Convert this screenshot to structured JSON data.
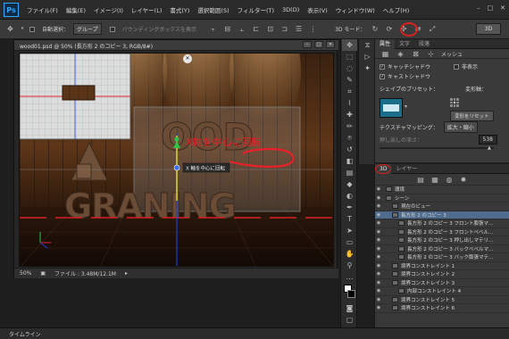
{
  "app": {
    "logo": "Ps"
  },
  "menu": [
    "ファイル(F)",
    "編集(E)",
    "イメージ(I)",
    "レイヤー(L)",
    "書式(Y)",
    "選択範囲(S)",
    "フィルター(T)",
    "3D(D)",
    "表示(V)",
    "ウィンドウ(W)",
    "ヘルプ(H)"
  ],
  "window_controls": [
    "–",
    "□",
    "✕"
  ],
  "options": {
    "auto_select_label": "自動選択：",
    "auto_select_value": "グループ",
    "bbox_label": "バウンディングボックスを表示",
    "mode3d_label": "3D モード：",
    "btn3d": "3D"
  },
  "document": {
    "title": "wood01.psd @ 50% (長方形 2 のコピー 3, RGB/8#)",
    "zoom": "50%",
    "file_info": "ファイル : 3.48M/12.1M",
    "close": "×",
    "win_btns": [
      "–",
      "□",
      "✕"
    ]
  },
  "canvas": {
    "scene_text_top": "OOD",
    "scene_text_bottom": "GRANING",
    "annotation": "X軸を中心に回転",
    "tooltip": "X 軸を中心に回転",
    "colors": {
      "annotation": "#e8202a",
      "axis_x": "#e4232b",
      "axis_y": "#d7d21e",
      "axis_z": "#1f3fd6",
      "wood": "#5a3418"
    }
  },
  "properties": {
    "tabs": [
      "属性",
      "文字",
      "段落"
    ],
    "mesh_label": "メッシュ",
    "catch_shadow": "キャッチシャドウ",
    "cast_shadow": "キャストシャドウ",
    "invisible": "非表示",
    "shape_preset_label": "シェイプのプリセット：",
    "deform_label": "変形軸：",
    "reset_deform": "変形をリセット",
    "texture_mapping_label": "テクスチャマッピング：",
    "texture_mapping_value": "拡大・縮小",
    "extrude_depth_label": "押し出しの深さ：",
    "extrude_depth_value": "538"
  },
  "layers": {
    "tabs": [
      "3D",
      "レイヤー"
    ],
    "items": [
      {
        "name": "環境",
        "indent": 0
      },
      {
        "name": "シーン",
        "indent": 0
      },
      {
        "name": "現在のビュー",
        "indent": 1
      },
      {
        "name": "長方形 2 のコピー 3",
        "indent": 1,
        "selected": true
      },
      {
        "name": "長方形 2 のコピー 3 フロント膨張マ...",
        "indent": 2
      },
      {
        "name": "長方形 2 のコピー 3 フロントベベル...",
        "indent": 2
      },
      {
        "name": "長方形 2 のコピー 3 押し出しマテリ...",
        "indent": 2
      },
      {
        "name": "長方形 2 のコピー 3 バックベベルマ...",
        "indent": 2
      },
      {
        "name": "長方形 2 のコピー 3 バック膨張マテ...",
        "indent": 2
      },
      {
        "name": "境界コンストレイント 1",
        "indent": 1
      },
      {
        "name": "境界コンストレイント 2",
        "indent": 1
      },
      {
        "name": "境界コンストレイント 3",
        "indent": 1
      },
      {
        "name": "内部コンストレイント 4",
        "indent": 2
      },
      {
        "name": "境界コンストレイント 5",
        "indent": 1
      },
      {
        "name": "境界コンストレイント 6",
        "indent": 1
      }
    ]
  },
  "timeline": {
    "label": "タイムライン"
  }
}
